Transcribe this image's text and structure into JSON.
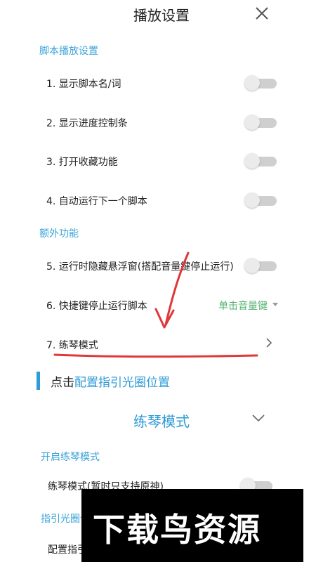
{
  "header": {
    "title": "播放设置"
  },
  "sections": {
    "script_playback": "脚本播放设置",
    "extra": "额外功能",
    "practice_enable": "开启练琴模式",
    "guide_ring": "指引光圈位"
  },
  "rows": {
    "show_script_name": "1. 显示脚本名/词",
    "show_progress": "2. 显示进度控制条",
    "favorites": "3. 打开收藏功能",
    "auto_next": "4. 自动运行下一个脚本",
    "hide_float": "5. 运行时隐藏悬浮窗(搭配音量键停止运行)",
    "shortcut_stop": "6. 快捷键停止运行脚本",
    "practice_mode": "7. 练琴模式",
    "practice_mode_toggle": "练琴模式(暂时只支持原神)",
    "config_guide": "配置指引"
  },
  "shortcut_value": "单击音量键",
  "hint": {
    "prefix": "点击",
    "link": "配置指引光圈位置"
  },
  "practice_panel": {
    "title": "练琴模式"
  },
  "toggles": {
    "show_script_name": false,
    "show_progress": false,
    "favorites": false,
    "auto_next": false,
    "hide_float": false,
    "practice_mode_toggle": false
  },
  "watermark": "下载鸟资源",
  "colors": {
    "accent_blue": "#2f9bd7",
    "section_blue": "#3aa3d8",
    "dropdown_green": "#52b36f",
    "annotation_red": "#e0373a"
  },
  "icons": {
    "close": "close-icon",
    "chevron_right": "chevron-right-icon",
    "chevron_down": "chevron-down-icon",
    "dropdown_caret": "caret-down-icon"
  }
}
